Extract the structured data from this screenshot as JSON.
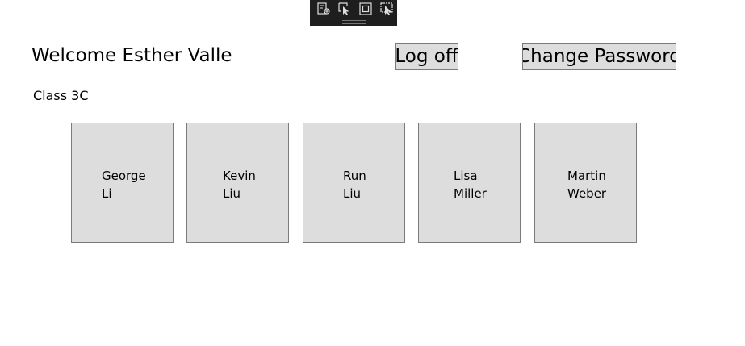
{
  "toolbar": {
    "buttons": [
      {
        "icon": "live-visual-tree-icon"
      },
      {
        "icon": "select-element-icon"
      },
      {
        "icon": "display-layout-adorners-icon"
      },
      {
        "icon": "track-focused-element-icon"
      }
    ]
  },
  "header": {
    "welcome": "Welcome Esther Valle",
    "logoff_label": "Log off",
    "change_password_label": "Change Password"
  },
  "class_label": "Class 3C",
  "students": [
    {
      "name": "George\nLi"
    },
    {
      "name": "Kevin\nLiu"
    },
    {
      "name": "Run\nLiu"
    },
    {
      "name": "Lisa\nMiller"
    },
    {
      "name": "Martin\nWeber"
    }
  ]
}
